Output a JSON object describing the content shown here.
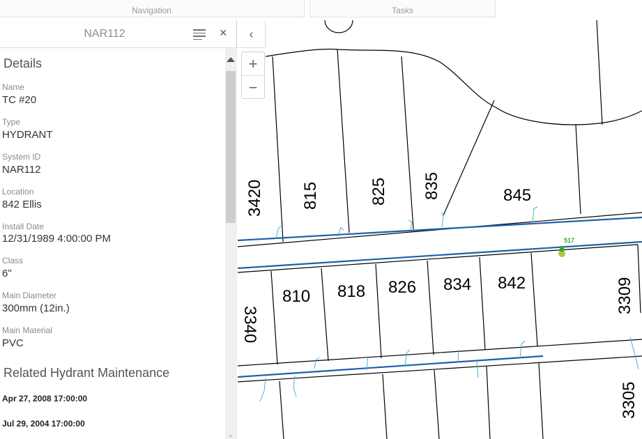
{
  "tabs": {
    "navigation": "Navigation",
    "tasks": "Tasks"
  },
  "panel": {
    "title": "NAR112",
    "menu_icon": "list-icon",
    "close_label": "×",
    "details_heading": "Details",
    "fields": [
      {
        "label": "Name",
        "value": "TC #20"
      },
      {
        "label": "Type",
        "value": "HYDRANT"
      },
      {
        "label": "System ID",
        "value": "NAR112"
      },
      {
        "label": "Location",
        "value": "842 Ellis"
      },
      {
        "label": "Install Date",
        "value": "12/31/1989 4:00:00 PM"
      },
      {
        "label": "Class",
        "value": "6\""
      },
      {
        "label": "Main Diameter",
        "value": "300mm (12in.)"
      },
      {
        "label": "Main Material",
        "value": "PVC"
      }
    ],
    "related_heading": "Related Hydrant Maintenance",
    "maintenance": [
      "Apr 27, 2008 17:00:00",
      "Jul 29, 2004 17:00:00"
    ]
  },
  "map": {
    "collapse_label": "‹",
    "zoom_in_label": "+",
    "zoom_out_label": "−",
    "selected_hydrant_label": "517",
    "parcel_labels_top": [
      "3420",
      "815",
      "825",
      "835",
      "845"
    ],
    "parcel_labels_bottom": [
      "810",
      "818",
      "826",
      "834",
      "842"
    ],
    "parcel_labels_side": [
      "3340",
      "3309",
      "3305"
    ],
    "colors": {
      "water_main": "#1f5fa8",
      "service_line": "#3fb3d6",
      "parcel_line": "#000000",
      "hydrant": "#b6c640",
      "hydrant_label": "#3aa03a"
    }
  }
}
